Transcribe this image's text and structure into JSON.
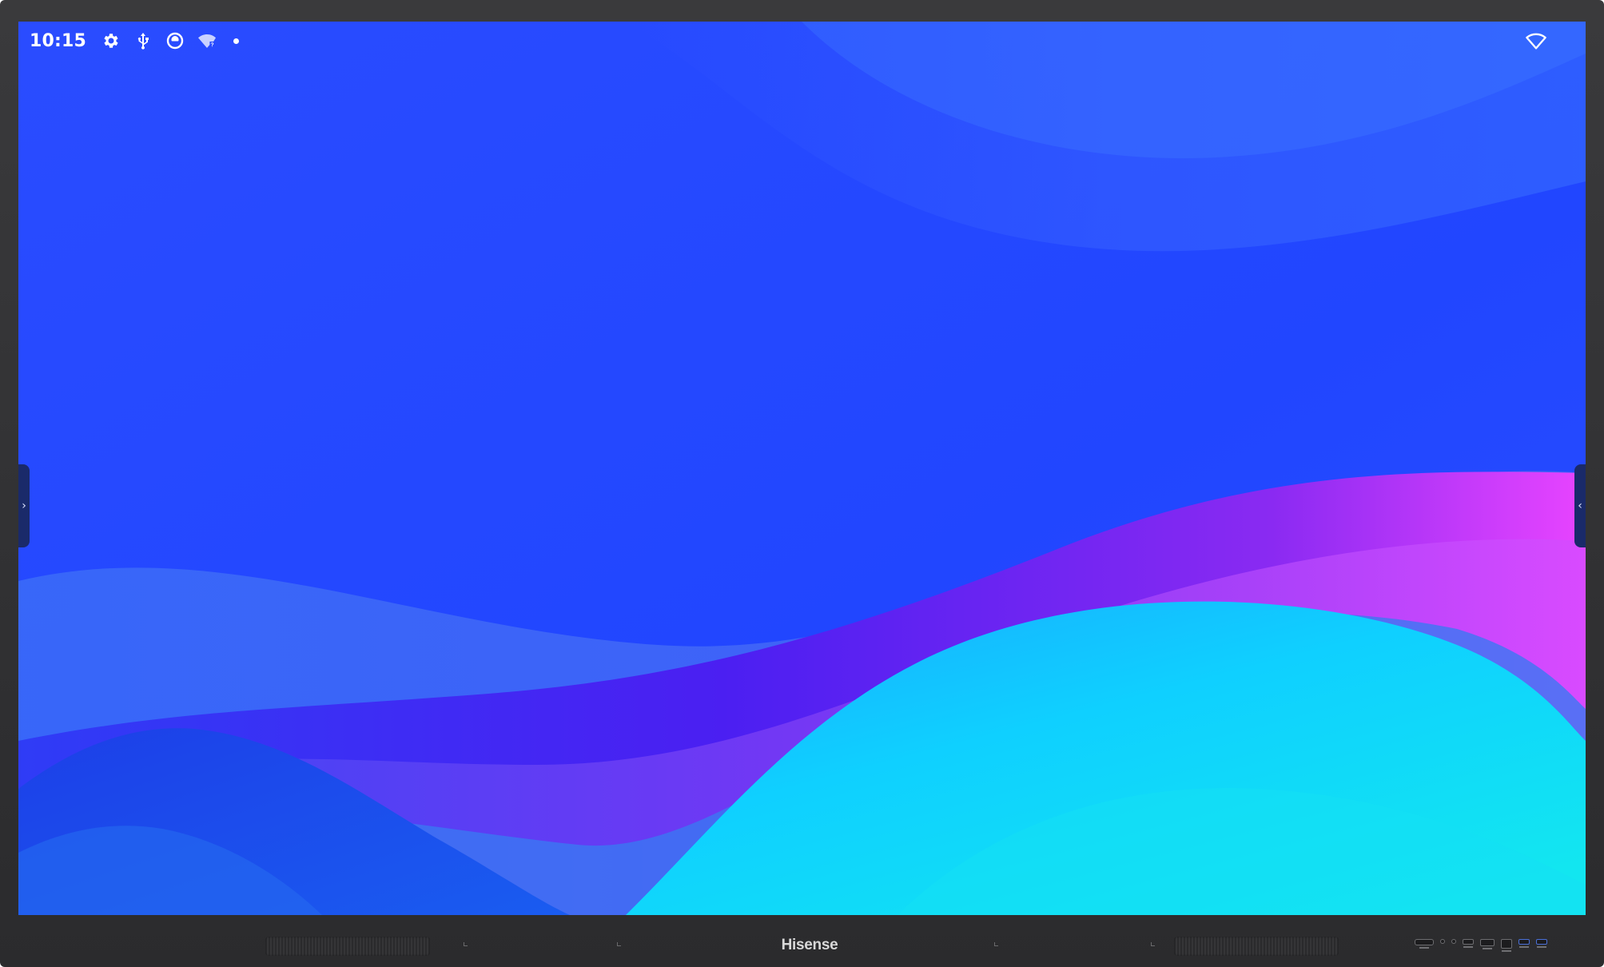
{
  "status_bar": {
    "time": "10:15",
    "left_icons": [
      "gear-icon",
      "usb-icon",
      "screen-record-icon",
      "wifi-unknown-icon",
      "notification-dot-icon"
    ],
    "right_icons": [
      "wifi-icon"
    ]
  },
  "edge_handles": {
    "left_glyph": "›",
    "right_glyph": "‹"
  },
  "bezel": {
    "brand": "Hisense"
  },
  "colors": {
    "wallpaper_base": "#2448ff",
    "wallpaper_violet": "#4a1cf0",
    "wallpaper_magenta": "#e040ff",
    "wallpaper_cyan": "#10d8ff",
    "bezel": "#2e2e30"
  }
}
